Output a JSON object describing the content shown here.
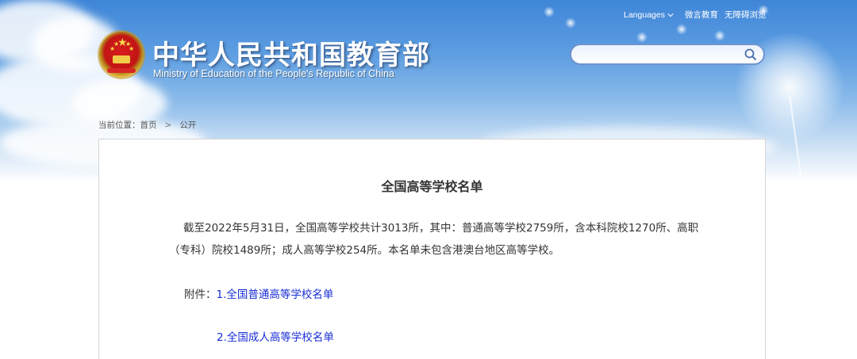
{
  "header": {
    "title_cn": "中华人民共和国教育部",
    "title_en": "Ministry of Education of the People's Republic of China",
    "top_links": {
      "languages": "Languages",
      "weibo": "微言教育",
      "accessible": "无障碍浏览"
    },
    "search": {
      "placeholder": ""
    }
  },
  "breadcrumb": {
    "label": "当前位置：",
    "home": "首页",
    "separator": ">",
    "current": "公开"
  },
  "article": {
    "title": "全国高等学校名单",
    "paragraph_line1": "截至2022年5月31日，全国高等学校共计3013所，其中：普通高等学校2759所，含本科院校1270所、高职",
    "paragraph_line2": "（专科）院校1489所；成人高等学校254所。本名单未包含港澳台地区高等学校。",
    "attachments_label": "附件：",
    "attachments": [
      {
        "number": "1.",
        "label": "全国普通高等学校名单"
      },
      {
        "number": "2.",
        "label": "全国成人高等学校名单"
      }
    ]
  },
  "colors": {
    "link": "#1a2fd6",
    "banner_top": "#3f86d8",
    "text": "#333333"
  }
}
